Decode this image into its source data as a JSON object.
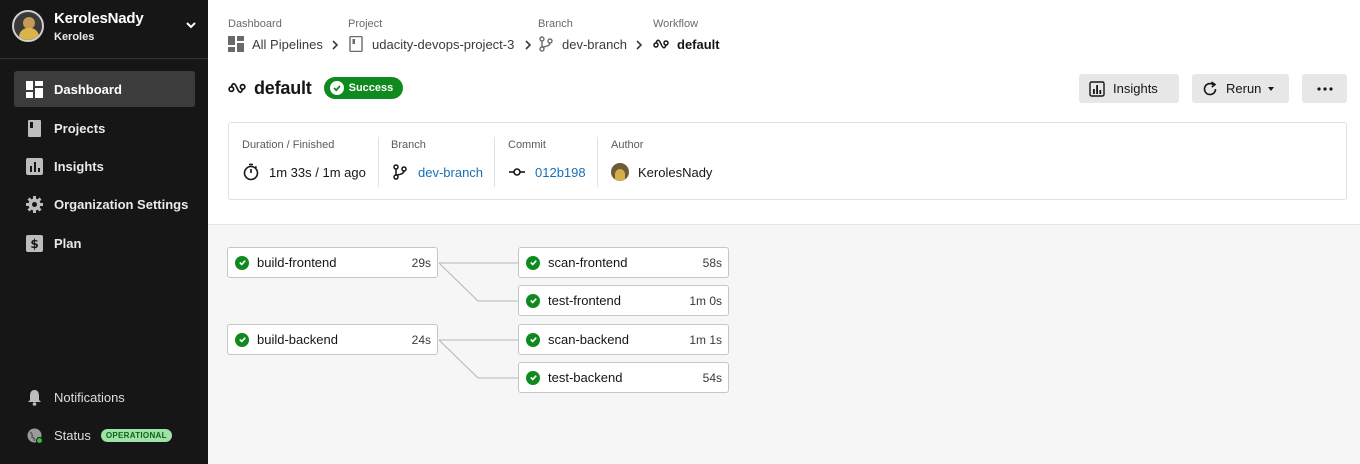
{
  "sidebar": {
    "org_name": "KerolesNady",
    "org_sub": "Keroles",
    "items": [
      {
        "label": "Dashboard"
      },
      {
        "label": "Projects"
      },
      {
        "label": "Insights"
      },
      {
        "label": "Organization Settings"
      },
      {
        "label": "Plan"
      }
    ],
    "footer": {
      "notifications": "Notifications",
      "status": "Status",
      "status_badge": "OPERATIONAL"
    }
  },
  "breadcrumb": [
    {
      "label": "Dashboard",
      "value": "All Pipelines",
      "icon": "pipelines-icon"
    },
    {
      "label": "Project",
      "value": "udacity-devops-project-3",
      "icon": "project-icon"
    },
    {
      "label": "Branch",
      "value": "dev-branch",
      "icon": "branch-icon"
    },
    {
      "label": "Workflow",
      "value": "default",
      "icon": "workflow-icon"
    }
  ],
  "header": {
    "title": "default",
    "status": "Success",
    "insights_button": "Insights",
    "rerun_button": "Rerun",
    "more_button": "more"
  },
  "info": {
    "duration_label": "Duration / Finished",
    "duration_value": "1m 33s / 1m ago",
    "branch_label": "Branch",
    "branch_value": "dev-branch",
    "commit_label": "Commit",
    "commit_value": "012b198",
    "author_label": "Author",
    "author_value": "KerolesNady"
  },
  "jobs": [
    {
      "name": "build-frontend",
      "duration": "29s",
      "status": "success"
    },
    {
      "name": "scan-frontend",
      "duration": "58s",
      "status": "success"
    },
    {
      "name": "test-frontend",
      "duration": "1m 0s",
      "status": "success"
    },
    {
      "name": "build-backend",
      "duration": "24s",
      "status": "success"
    },
    {
      "name": "scan-backend",
      "duration": "1m 1s",
      "status": "success"
    },
    {
      "name": "test-backend",
      "duration": "54s",
      "status": "success"
    }
  ],
  "colors": {
    "sidebar_bg": "#161616",
    "success": "#0f8a1f",
    "link": "#1a6fb4",
    "status_badge_bg": "#9ee3a5"
  }
}
